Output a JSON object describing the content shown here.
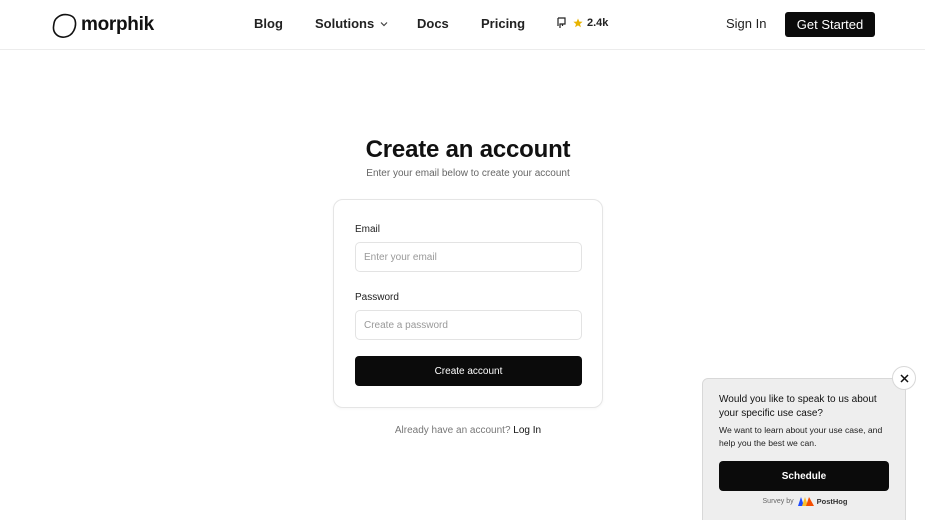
{
  "header": {
    "logo_text": "morphik",
    "nav": {
      "blog": "Blog",
      "solutions": "Solutions",
      "docs": "Docs",
      "pricing": "Pricing"
    },
    "github_stars": "2.4k",
    "sign_in": "Sign In",
    "get_started": "Get Started"
  },
  "main": {
    "title": "Create an account",
    "subtitle": "Enter your email below to create your account",
    "email_label": "Email",
    "email_placeholder": "Enter your email",
    "password_label": "Password",
    "password_placeholder": "Create a password",
    "create_button": "Create account",
    "already_text": "Already have an account?",
    "login_link": "Log In"
  },
  "survey": {
    "question": "Would you like to speak to us about your specific use case?",
    "description": "We want to learn about your use case, and help you the best we can.",
    "button": "Schedule",
    "survey_by": "Survey by",
    "brand": "PostHog"
  },
  "icons": {
    "logo": "morphik-logo-icon",
    "chevron": "chevron-down-icon",
    "github": "github-icon",
    "star": "star-icon",
    "close": "close-icon",
    "posthog": "posthog-logo-icon"
  },
  "colors": {
    "primary": "#0b0b0b",
    "star": "#e8b400",
    "popup_bg": "#eeeeee"
  }
}
